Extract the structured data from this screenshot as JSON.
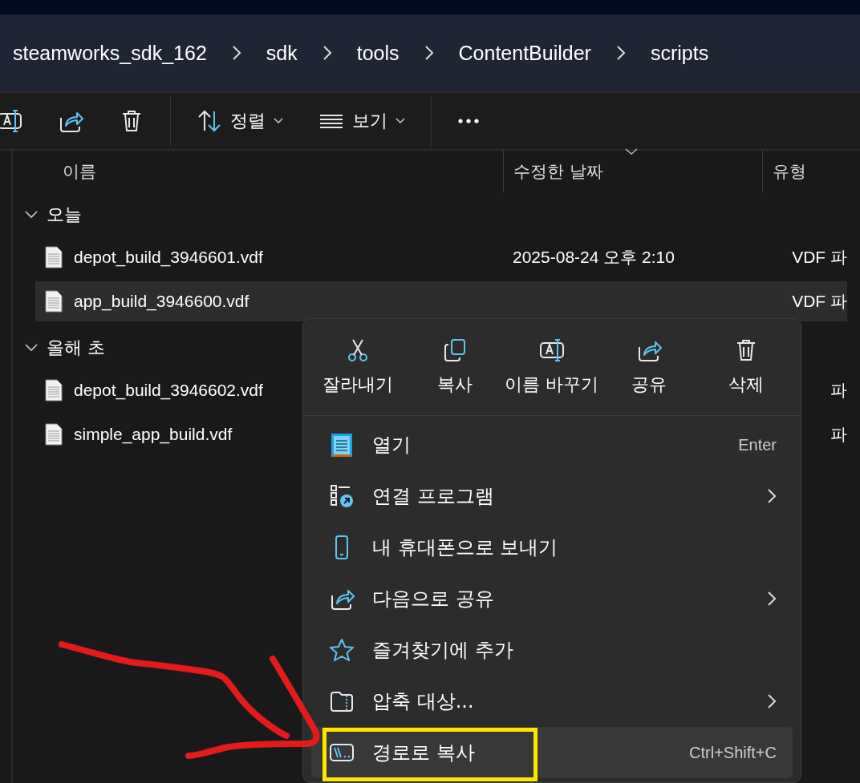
{
  "breadcrumb": [
    {
      "label": "steamworks_sdk_162"
    },
    {
      "label": "sdk"
    },
    {
      "label": "tools"
    },
    {
      "label": "ContentBuilder"
    },
    {
      "label": "scripts"
    }
  ],
  "toolbar": [
    {
      "kind": "rename"
    },
    {
      "kind": "share"
    },
    {
      "kind": "delete"
    },
    {
      "kind": "separator"
    },
    {
      "kind": "sort",
      "label": "정렬"
    },
    {
      "kind": "view",
      "label": "보기"
    },
    {
      "kind": "separator"
    },
    {
      "kind": "more"
    }
  ],
  "columns": [
    {
      "label": "이름",
      "sorted": false
    },
    {
      "label": "수정한 날짜",
      "sorted": true
    },
    {
      "label": "유형",
      "sorted": false
    }
  ],
  "groups": [
    {
      "label": "오늘",
      "expanded": true,
      "files": [
        {
          "name": "depot_build_3946601.vdf",
          "date": "2025-08-24 오후 2:10",
          "type": "VDF 파",
          "selected": false
        },
        {
          "name": "app_build_3946600.vdf",
          "type": "VDF 파",
          "selected": true
        }
      ]
    },
    {
      "label": "올해 초",
      "expanded": true,
      "files": [
        {
          "name": "depot_build_3946602.vdf",
          "type": "파",
          "selected": false
        },
        {
          "name": "simple_app_build.vdf",
          "type": "파",
          "selected": false
        }
      ]
    }
  ],
  "context_menu": {
    "actions": [
      {
        "kind": "cut",
        "label": "잘라내기"
      },
      {
        "kind": "copy",
        "label": "복사"
      },
      {
        "kind": "rename",
        "label": "이름 바꾸기"
      },
      {
        "kind": "share",
        "label": "공유"
      },
      {
        "kind": "delete",
        "label": "삭제"
      }
    ],
    "items": [
      {
        "kind": "notepad",
        "label": "열기",
        "shortcut": "Enter",
        "submenu": false,
        "hovered": false
      },
      {
        "kind": "openwith",
        "label": "연결 프로그램",
        "submenu": true,
        "hovered": false
      },
      {
        "kind": "phone",
        "label": "내 휴대폰으로 보내기",
        "submenu": false,
        "hovered": false
      },
      {
        "kind": "share",
        "label": "다음으로 공유",
        "submenu": true,
        "hovered": false
      },
      {
        "kind": "star",
        "label": "즐겨찾기에 추가",
        "submenu": false,
        "hovered": false
      },
      {
        "kind": "zip",
        "label": "압축 대상...",
        "submenu": true,
        "hovered": false
      },
      {
        "kind": "path",
        "label": "경로로 복사",
        "shortcut": "Ctrl+Shift+C",
        "submenu": false,
        "hovered": true
      }
    ]
  },
  "annotations": [
    {
      "kind": "arrow",
      "color": "#e31b1b"
    },
    {
      "kind": "box",
      "color": "#ffe600"
    }
  ]
}
